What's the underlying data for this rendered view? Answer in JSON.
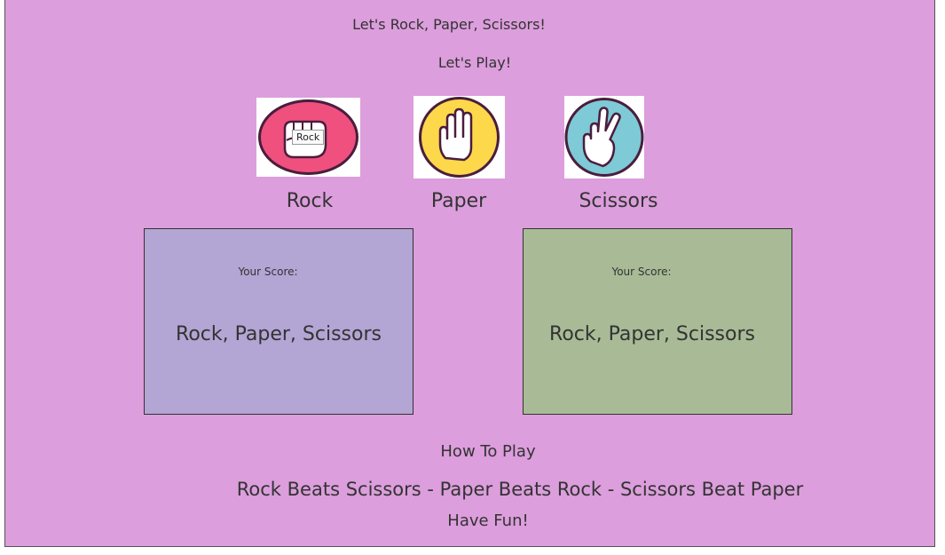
{
  "header": {
    "title": "Let's Rock, Paper, Scissors!",
    "subtitle": "Let's Play!"
  },
  "choices": [
    {
      "label": "Rock",
      "icon": "rock-fist-icon",
      "color": "#f0507e",
      "tooltip": "Rock"
    },
    {
      "label": "Paper",
      "icon": "paper-hand-icon",
      "color": "#fcd84a"
    },
    {
      "label": "Scissors",
      "icon": "scissors-hand-icon",
      "color": "#7ecad6"
    }
  ],
  "scoreboards": [
    {
      "label": "Your Score:",
      "choice_text": "Rock, Paper, Scissors",
      "color": "#b3a5d4"
    },
    {
      "label": "Your Score:",
      "choice_text": "Rock, Paper, Scissors",
      "color": "#a8bb96"
    }
  ],
  "footer": {
    "heading": "How To Play",
    "rules": "Rock Beats Scissors - Paper Beats Rock - Scissors Beat Paper",
    "closing": "Have Fun!"
  },
  "colors": {
    "background": "#dc9edc",
    "text": "#333333"
  }
}
